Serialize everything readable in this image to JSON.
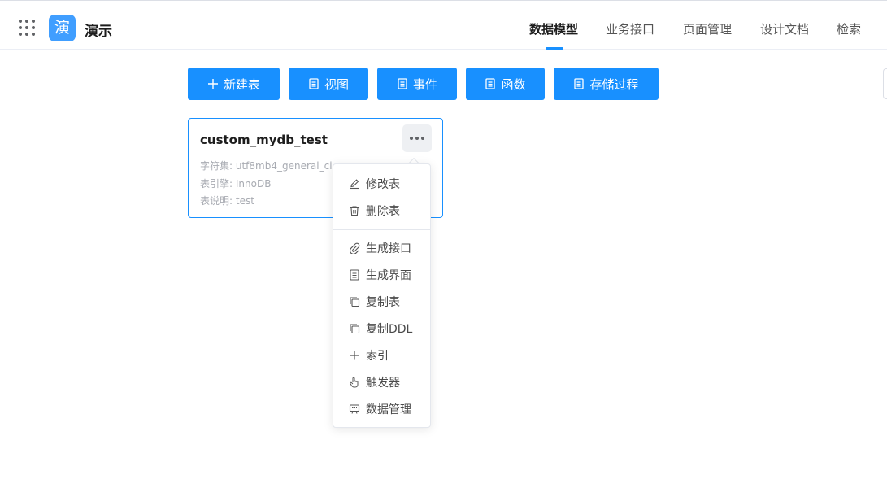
{
  "app": {
    "logo_char": "演",
    "name": "演示"
  },
  "nav": {
    "items": [
      {
        "label": "数据模型",
        "active": true
      },
      {
        "label": "业务接口",
        "active": false
      },
      {
        "label": "页面管理",
        "active": false
      },
      {
        "label": "设计文档",
        "active": false
      },
      {
        "label": "检索",
        "active": false
      }
    ]
  },
  "toolbar": {
    "buttons": [
      {
        "label": "新建表",
        "icon": "plus-icon"
      },
      {
        "label": "视图",
        "icon": "document-icon"
      },
      {
        "label": "事件",
        "icon": "document-icon"
      },
      {
        "label": "函数",
        "icon": "document-icon"
      },
      {
        "label": "存储过程",
        "icon": "document-icon"
      }
    ]
  },
  "table_card": {
    "title": "custom_mydb_test",
    "charset_label": "字符集:",
    "charset_value": "utf8mb4_general_ci",
    "engine_label": "表引擎:",
    "engine_value": "InnoDB",
    "desc_label": "表说明:",
    "desc_value": "test"
  },
  "context_menu": {
    "items": [
      {
        "label": "修改表",
        "icon": "edit-icon"
      },
      {
        "label": "删除表",
        "icon": "trash-icon"
      },
      {
        "label": "生成接口",
        "icon": "paperclip-icon"
      },
      {
        "label": "生成界面",
        "icon": "document-icon"
      },
      {
        "label": "复制表",
        "icon": "copy-icon"
      },
      {
        "label": "复制DDL",
        "icon": "copy-icon"
      },
      {
        "label": "索引",
        "icon": "plus-icon"
      },
      {
        "label": "触发器",
        "icon": "pointer-hand-icon"
      },
      {
        "label": "数据管理",
        "icon": "data-manage-icon"
      }
    ]
  },
  "colors": {
    "primary": "#1890ff",
    "logo_bg": "#409eff",
    "text": "#303133",
    "muted": "#a8abb2"
  }
}
